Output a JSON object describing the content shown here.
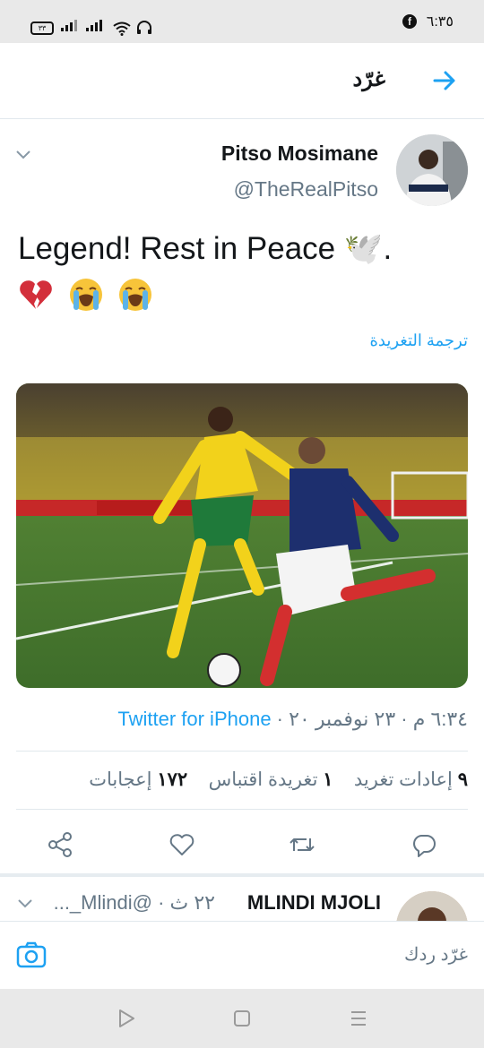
{
  "status_bar": {
    "time": "٦:٣٥",
    "battery": "٣٣",
    "fb_glyph": "f"
  },
  "header": {
    "title": "غرّد"
  },
  "tweet": {
    "author_name": "Pitso Mosimane",
    "author_handle": "@TheRealPitso",
    "text": "Legend! Rest in Peace 🕊️.",
    "translate_label": "ترجمة التغريدة",
    "timestamp": "٦:٣٤ م · ٢٣ نوفمبر ٢٠ · ",
    "source": "Twitter for iPhone",
    "retweets_count": "٩",
    "retweets_label": "إعادات تغريد",
    "quotes_count": "١",
    "quotes_label": "تغريدة اقتباس",
    "likes_count": "١٧٢",
    "likes_label": "إعجابات"
  },
  "reply_preview": {
    "author_name": "MLINDI MJOLI",
    "author_meta": "٢٢ ث · @Mlindi_..."
  },
  "compose": {
    "placeholder": "غرّد ردك"
  },
  "icons": {
    "back": "arrow-right-icon",
    "chevron": "chevron-down-icon",
    "share": "share-icon",
    "like": "heart-icon",
    "retweet": "retweet-icon",
    "reply": "reply-icon",
    "camera": "camera-icon"
  },
  "colors": {
    "accent": "#1da1f2",
    "secondary_text": "#657786",
    "divider": "#e1e8ed"
  }
}
